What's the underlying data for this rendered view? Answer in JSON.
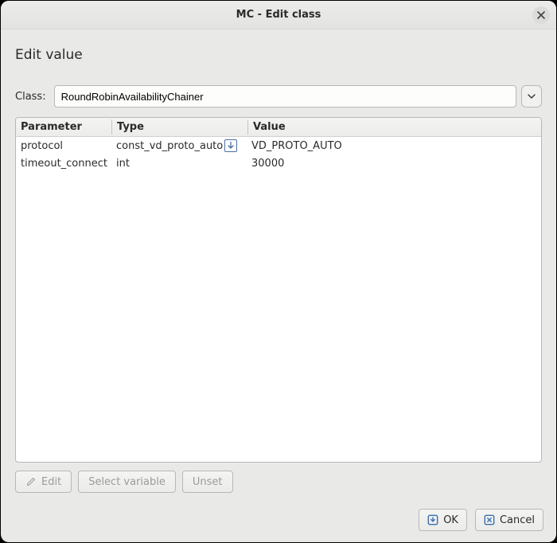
{
  "window": {
    "title": "MC - Edit class"
  },
  "heading": "Edit value",
  "class_field": {
    "label": "Class:",
    "value": "RoundRobinAvailabilityChainer"
  },
  "table": {
    "headers": {
      "param": "Parameter",
      "type": "Type",
      "value": "Value"
    },
    "rows": [
      {
        "param": "protocol",
        "type": "const_vd_proto_auto",
        "has_glyph": true,
        "value": "VD_PROTO_AUTO"
      },
      {
        "param": "timeout_connect",
        "type": "int",
        "has_glyph": false,
        "value": "30000"
      }
    ]
  },
  "toolbar": {
    "edit": "Edit",
    "select_variable": "Select variable",
    "unset": "Unset"
  },
  "footer": {
    "ok": "OK",
    "cancel": "Cancel"
  }
}
